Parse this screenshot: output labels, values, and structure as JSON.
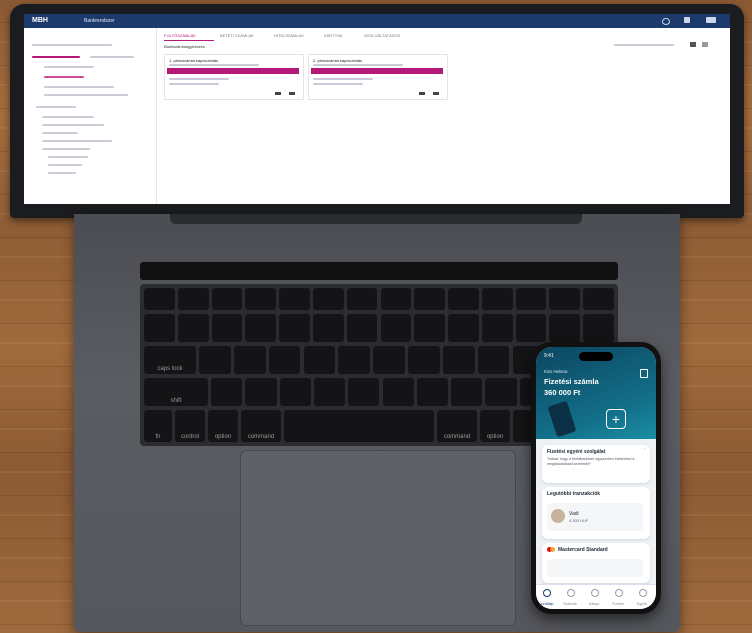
{
  "webapp": {
    "logo": "MBH",
    "app_name": "Bankrendszer",
    "tabs": [
      "FOLYÓSZÁMLÁK",
      "BETÉTI SZÁMLÁK",
      "HITELSZÁMLÁK",
      "KÁRTYÁK",
      "SZOLGÁLTATÁSOK"
    ],
    "section_title": "Bankszámlaügyintézés",
    "card_titles": [
      "1. pénzszámla kapcsolódás",
      "2. pénzszámla kapcsolódás"
    ]
  },
  "keyboard": {
    "row_labels": {
      "caps": "caps lock",
      "shift": "shift",
      "fn": "fn",
      "control": "control",
      "option": "option",
      "command": "command"
    }
  },
  "phone": {
    "time": "9:41",
    "greeting": "Kiss Helena",
    "account_name": "Fizetési számla",
    "balance": "360 000 Ft",
    "promo_title": "Fizetési egyéni szolgálat",
    "promo_text": "Tudtad, hogy a Mobilbankban egyszerűen intézheted a megtakarításaid kezelését?",
    "recent_title": "Legutóbbi tranzakciók",
    "tx_name": "Vadi",
    "tx_amount": "4 300 HUF",
    "card_name": "Mastercard Standard",
    "tabs": [
      "Kezdőlap",
      "Számlák",
      "Kártya",
      "Fizetés",
      "Egyéb"
    ],
    "colors": {
      "header": "#0c4660",
      "accent": "#13708a",
      "card_logo_red": "#eb001b",
      "card_logo_yellow": "#f79e1b"
    }
  }
}
